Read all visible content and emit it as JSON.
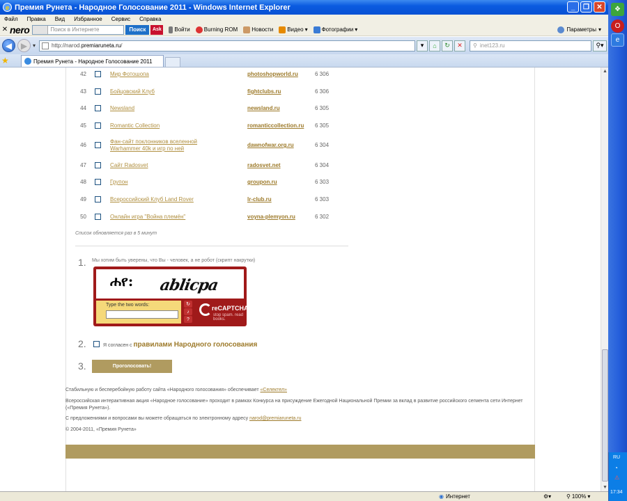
{
  "window": {
    "title": "Премия Рунета - Народное Голосование 2011 - Windows Internet Explorer"
  },
  "menu": [
    "Файл",
    "Правка",
    "Вид",
    "Избранное",
    "Сервис",
    "Справка"
  ],
  "nero_toolbar": {
    "logo": "nero",
    "search_placeholder": "Поиск в Интернете",
    "search_button": "Поиск",
    "ask_label": "Ask",
    "items": [
      "Войти",
      "Burning ROM",
      "Новости",
      "Видео",
      "Фотографии"
    ],
    "params": "Параметры"
  },
  "address": {
    "url_prefix": "http://narod.",
    "url_domain": "premiaruneta.ru",
    "url_suffix": "/",
    "search_placeholder": "inet123.ru"
  },
  "tab": {
    "title": "Премия Рунета - Народное Голосование 2011"
  },
  "list": [
    {
      "num": "42",
      "name": "Мир Фотошопа",
      "site": "photoshopworld.ru",
      "votes": "6 306"
    },
    {
      "num": "43",
      "name": "Бойцовский Клуб",
      "site": "fightclubs.ru",
      "votes": "6 306"
    },
    {
      "num": "44",
      "name": "Newsland",
      "site": "newsland.ru",
      "votes": "6 305"
    },
    {
      "num": "45",
      "name": "Romantic Collection",
      "site": "romanticcollection.ru",
      "votes": "6 305"
    },
    {
      "num": "46",
      "name": "Фан-сайт поклонников вселенной Warhammer 40k и игр по ней",
      "site": "dawnofwar.org.ru",
      "votes": "6 304"
    },
    {
      "num": "47",
      "name": "Сайт Radosvet",
      "site": "radosvet.net",
      "votes": "6 304"
    },
    {
      "num": "48",
      "name": "Групон",
      "site": "groupon.ru",
      "votes": "6 303"
    },
    {
      "num": "49",
      "name": "Всероссийский Клуб Land Rover",
      "site": "lr-club.ru",
      "votes": "6 303"
    },
    {
      "num": "50",
      "name": "Онлайн игра \"Война племён\"",
      "site": "voyna-plemyon.ru",
      "votes": "6 302"
    }
  ],
  "note": "Список обновляется раз в 5 минут",
  "step1": {
    "num": "1.",
    "text": "Мы хотим быть уверены, что Вы - человек, а не робот (скрипт накрутки)"
  },
  "captcha": {
    "word1": "ሐየ:",
    "word2": "ablicpa",
    "label": "Type the two words:",
    "logo": "reCAPTCHA™",
    "tagline": "stop spam. read books."
  },
  "step2": {
    "num": "2.",
    "text": "Я согласен с ",
    "link": "правилами Народного голосования"
  },
  "step3": {
    "num": "3.",
    "button": "Проголосовать!"
  },
  "footer": {
    "p1_text": "Стабильную и бесперебойную работу сайта «Народного голосования» обеспечивает ",
    "p1_link": "«Селектел»",
    "p2": "Всероссийская интерактивная акция «Народное голосование» проходит в рамках Конкурса на присуждение Ежегодной Национальной Премии за вклад в развитие российского сегмента сети Интернет («Премия Рунета»).",
    "p3_text": "С предложениями и вопросами вы можете обращаться по электронному адресу ",
    "p3_link": "narod@premiaruneta.ru",
    "p4": "© 2004-2011, «Премия Рунета»"
  },
  "status": {
    "zone": "Интернет",
    "zoom": "100%"
  },
  "tray": {
    "lang": "RU",
    "time": "17:34"
  }
}
